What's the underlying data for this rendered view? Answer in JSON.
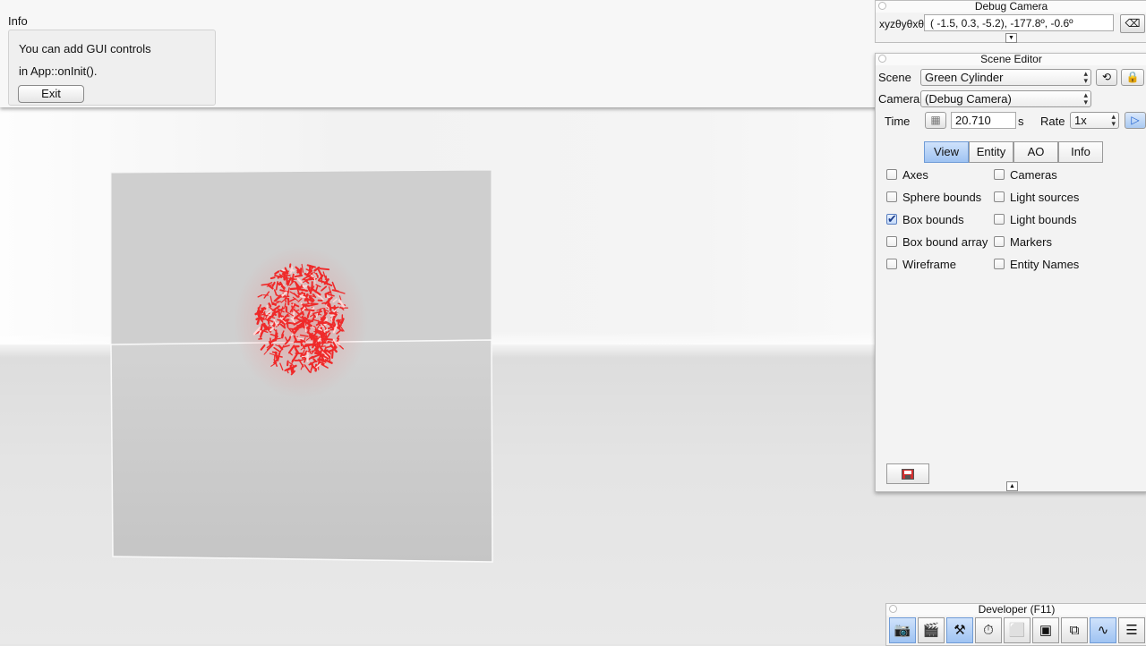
{
  "info": {
    "title": "Info",
    "line1": "You can add GUI controls",
    "line2": "in App::onInit().",
    "exit_label": "Exit"
  },
  "debug_camera": {
    "title": "Debug Camera",
    "xyz_label": "xyzθyθxθz",
    "xyz_value": "( -1.5,   0.3,  -5.2), -177.8º,  -0.6º",
    "collapse_icon": "▼"
  },
  "scene_editor": {
    "title": "Scene Editor",
    "scene_label": "Scene",
    "scene_value": "Green Cylinder",
    "camera_label": "Camera",
    "camera_value": "(Debug Camera)",
    "time_label": "Time",
    "time_value": "20.710",
    "time_unit": "s",
    "rate_label": "Rate",
    "rate_value": "1x",
    "tabs": [
      {
        "label": "View",
        "active": true
      },
      {
        "label": "Entity",
        "active": false
      },
      {
        "label": "AO",
        "active": false
      },
      {
        "label": "Info",
        "active": false
      }
    ],
    "options_left": [
      {
        "label": "Axes",
        "checked": false
      },
      {
        "label": "Sphere bounds",
        "checked": false
      },
      {
        "label": "Box bounds",
        "checked": true
      },
      {
        "label": "Box bound array",
        "checked": false
      },
      {
        "label": "Wireframe",
        "checked": false
      }
    ],
    "options_right": [
      {
        "label": "Cameras",
        "checked": false
      },
      {
        "label": "Light sources",
        "checked": false
      },
      {
        "label": "Light bounds",
        "checked": false
      },
      {
        "label": "Markers",
        "checked": false
      },
      {
        "label": "Entity Names",
        "checked": false
      }
    ],
    "collapse_icon": "▲"
  },
  "developer": {
    "title": "Developer (F11)",
    "tools": [
      {
        "name": "camera-icon",
        "glyph": "📷",
        "active": true
      },
      {
        "name": "clapperboard-icon",
        "glyph": "🎬",
        "active": false
      },
      {
        "name": "tools-icon",
        "glyph": "⚒",
        "active": true
      },
      {
        "name": "profiler-icon",
        "glyph": "⏱",
        "active": false
      },
      {
        "name": "new-window-icon",
        "glyph": "⬜",
        "active": false
      },
      {
        "name": "console-icon",
        "glyph": "▣",
        "active": false
      },
      {
        "name": "windows-icon",
        "glyph": "⧉",
        "active": false
      },
      {
        "name": "graph-icon",
        "glyph": "∿",
        "active": true
      },
      {
        "name": "document-icon",
        "glyph": "☰",
        "active": false
      }
    ]
  },
  "colors": {
    "accent_blue": "#9fc3f2",
    "object_red": "#ef2a2a"
  }
}
